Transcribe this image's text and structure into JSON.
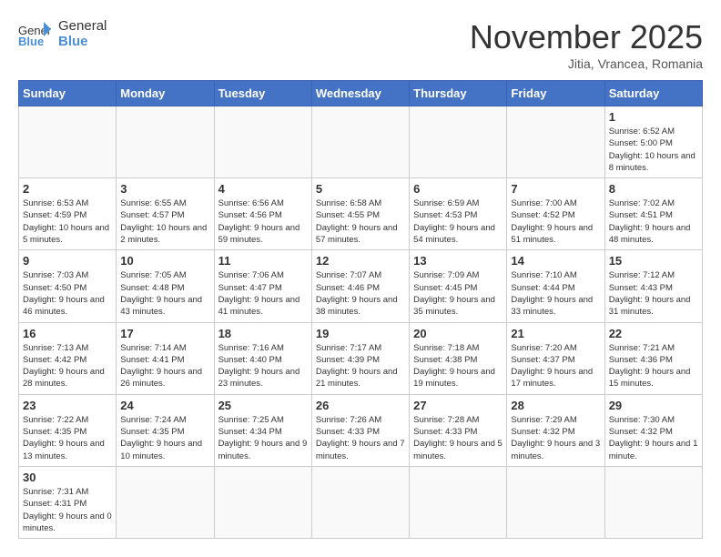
{
  "header": {
    "logo_general": "General",
    "logo_blue": "Blue",
    "month_title": "November 2025",
    "location": "Jitia, Vrancea, Romania"
  },
  "weekdays": [
    "Sunday",
    "Monday",
    "Tuesday",
    "Wednesday",
    "Thursday",
    "Friday",
    "Saturday"
  ],
  "weeks": [
    [
      {
        "day": "",
        "info": ""
      },
      {
        "day": "",
        "info": ""
      },
      {
        "day": "",
        "info": ""
      },
      {
        "day": "",
        "info": ""
      },
      {
        "day": "",
        "info": ""
      },
      {
        "day": "",
        "info": ""
      },
      {
        "day": "1",
        "info": "Sunrise: 6:52 AM\nSunset: 5:00 PM\nDaylight: 10 hours and 8 minutes."
      }
    ],
    [
      {
        "day": "2",
        "info": "Sunrise: 6:53 AM\nSunset: 4:59 PM\nDaylight: 10 hours and 5 minutes."
      },
      {
        "day": "3",
        "info": "Sunrise: 6:55 AM\nSunset: 4:57 PM\nDaylight: 10 hours and 2 minutes."
      },
      {
        "day": "4",
        "info": "Sunrise: 6:56 AM\nSunset: 4:56 PM\nDaylight: 9 hours and 59 minutes."
      },
      {
        "day": "5",
        "info": "Sunrise: 6:58 AM\nSunset: 4:55 PM\nDaylight: 9 hours and 57 minutes."
      },
      {
        "day": "6",
        "info": "Sunrise: 6:59 AM\nSunset: 4:53 PM\nDaylight: 9 hours and 54 minutes."
      },
      {
        "day": "7",
        "info": "Sunrise: 7:00 AM\nSunset: 4:52 PM\nDaylight: 9 hours and 51 minutes."
      },
      {
        "day": "8",
        "info": "Sunrise: 7:02 AM\nSunset: 4:51 PM\nDaylight: 9 hours and 48 minutes."
      }
    ],
    [
      {
        "day": "9",
        "info": "Sunrise: 7:03 AM\nSunset: 4:50 PM\nDaylight: 9 hours and 46 minutes."
      },
      {
        "day": "10",
        "info": "Sunrise: 7:05 AM\nSunset: 4:48 PM\nDaylight: 9 hours and 43 minutes."
      },
      {
        "day": "11",
        "info": "Sunrise: 7:06 AM\nSunset: 4:47 PM\nDaylight: 9 hours and 41 minutes."
      },
      {
        "day": "12",
        "info": "Sunrise: 7:07 AM\nSunset: 4:46 PM\nDaylight: 9 hours and 38 minutes."
      },
      {
        "day": "13",
        "info": "Sunrise: 7:09 AM\nSunset: 4:45 PM\nDaylight: 9 hours and 35 minutes."
      },
      {
        "day": "14",
        "info": "Sunrise: 7:10 AM\nSunset: 4:44 PM\nDaylight: 9 hours and 33 minutes."
      },
      {
        "day": "15",
        "info": "Sunrise: 7:12 AM\nSunset: 4:43 PM\nDaylight: 9 hours and 31 minutes."
      }
    ],
    [
      {
        "day": "16",
        "info": "Sunrise: 7:13 AM\nSunset: 4:42 PM\nDaylight: 9 hours and 28 minutes."
      },
      {
        "day": "17",
        "info": "Sunrise: 7:14 AM\nSunset: 4:41 PM\nDaylight: 9 hours and 26 minutes."
      },
      {
        "day": "18",
        "info": "Sunrise: 7:16 AM\nSunset: 4:40 PM\nDaylight: 9 hours and 23 minutes."
      },
      {
        "day": "19",
        "info": "Sunrise: 7:17 AM\nSunset: 4:39 PM\nDaylight: 9 hours and 21 minutes."
      },
      {
        "day": "20",
        "info": "Sunrise: 7:18 AM\nSunset: 4:38 PM\nDaylight: 9 hours and 19 minutes."
      },
      {
        "day": "21",
        "info": "Sunrise: 7:20 AM\nSunset: 4:37 PM\nDaylight: 9 hours and 17 minutes."
      },
      {
        "day": "22",
        "info": "Sunrise: 7:21 AM\nSunset: 4:36 PM\nDaylight: 9 hours and 15 minutes."
      }
    ],
    [
      {
        "day": "23",
        "info": "Sunrise: 7:22 AM\nSunset: 4:35 PM\nDaylight: 9 hours and 13 minutes."
      },
      {
        "day": "24",
        "info": "Sunrise: 7:24 AM\nSunset: 4:35 PM\nDaylight: 9 hours and 10 minutes."
      },
      {
        "day": "25",
        "info": "Sunrise: 7:25 AM\nSunset: 4:34 PM\nDaylight: 9 hours and 9 minutes."
      },
      {
        "day": "26",
        "info": "Sunrise: 7:26 AM\nSunset: 4:33 PM\nDaylight: 9 hours and 7 minutes."
      },
      {
        "day": "27",
        "info": "Sunrise: 7:28 AM\nSunset: 4:33 PM\nDaylight: 9 hours and 5 minutes."
      },
      {
        "day": "28",
        "info": "Sunrise: 7:29 AM\nSunset: 4:32 PM\nDaylight: 9 hours and 3 minutes."
      },
      {
        "day": "29",
        "info": "Sunrise: 7:30 AM\nSunset: 4:32 PM\nDaylight: 9 hours and 1 minute."
      }
    ],
    [
      {
        "day": "30",
        "info": "Sunrise: 7:31 AM\nSunset: 4:31 PM\nDaylight: 9 hours and 0 minutes."
      },
      {
        "day": "",
        "info": ""
      },
      {
        "day": "",
        "info": ""
      },
      {
        "day": "",
        "info": ""
      },
      {
        "day": "",
        "info": ""
      },
      {
        "day": "",
        "info": ""
      },
      {
        "day": "",
        "info": ""
      }
    ]
  ]
}
